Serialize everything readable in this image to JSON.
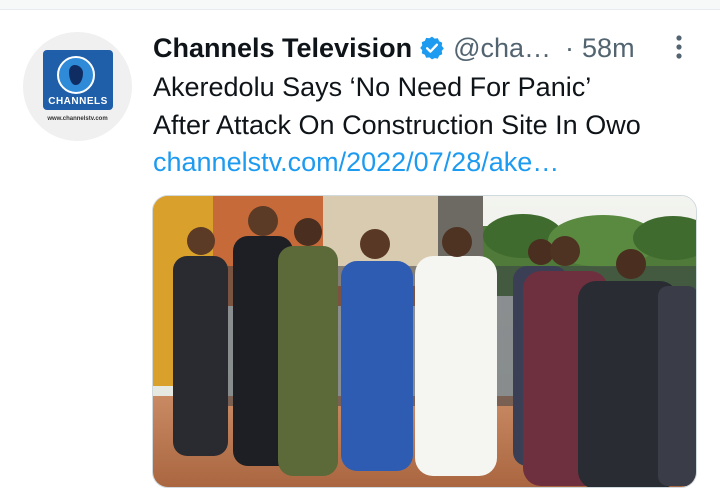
{
  "tweet": {
    "author_name": "Channels Television",
    "handle": "@cha…",
    "separator": "·",
    "time": "58m",
    "text_line1": "Akeredolu Says ‘No Need For Panic’",
    "text_line2": "After Attack On Construction Site In Owo",
    "link": "channelstv.com/2022/07/28/ake…"
  },
  "avatar_logo": {
    "wordmark": "CHANNELS",
    "url": "www.channelstv.com"
  },
  "icons": {
    "verified": "verified-badge-icon",
    "more": "more-vertical-icon"
  },
  "colors": {
    "link": "#1d9bf0",
    "verified": "#1d9bf0",
    "secondary_text": "#536471",
    "brand_blue": "#1f5ea8"
  }
}
